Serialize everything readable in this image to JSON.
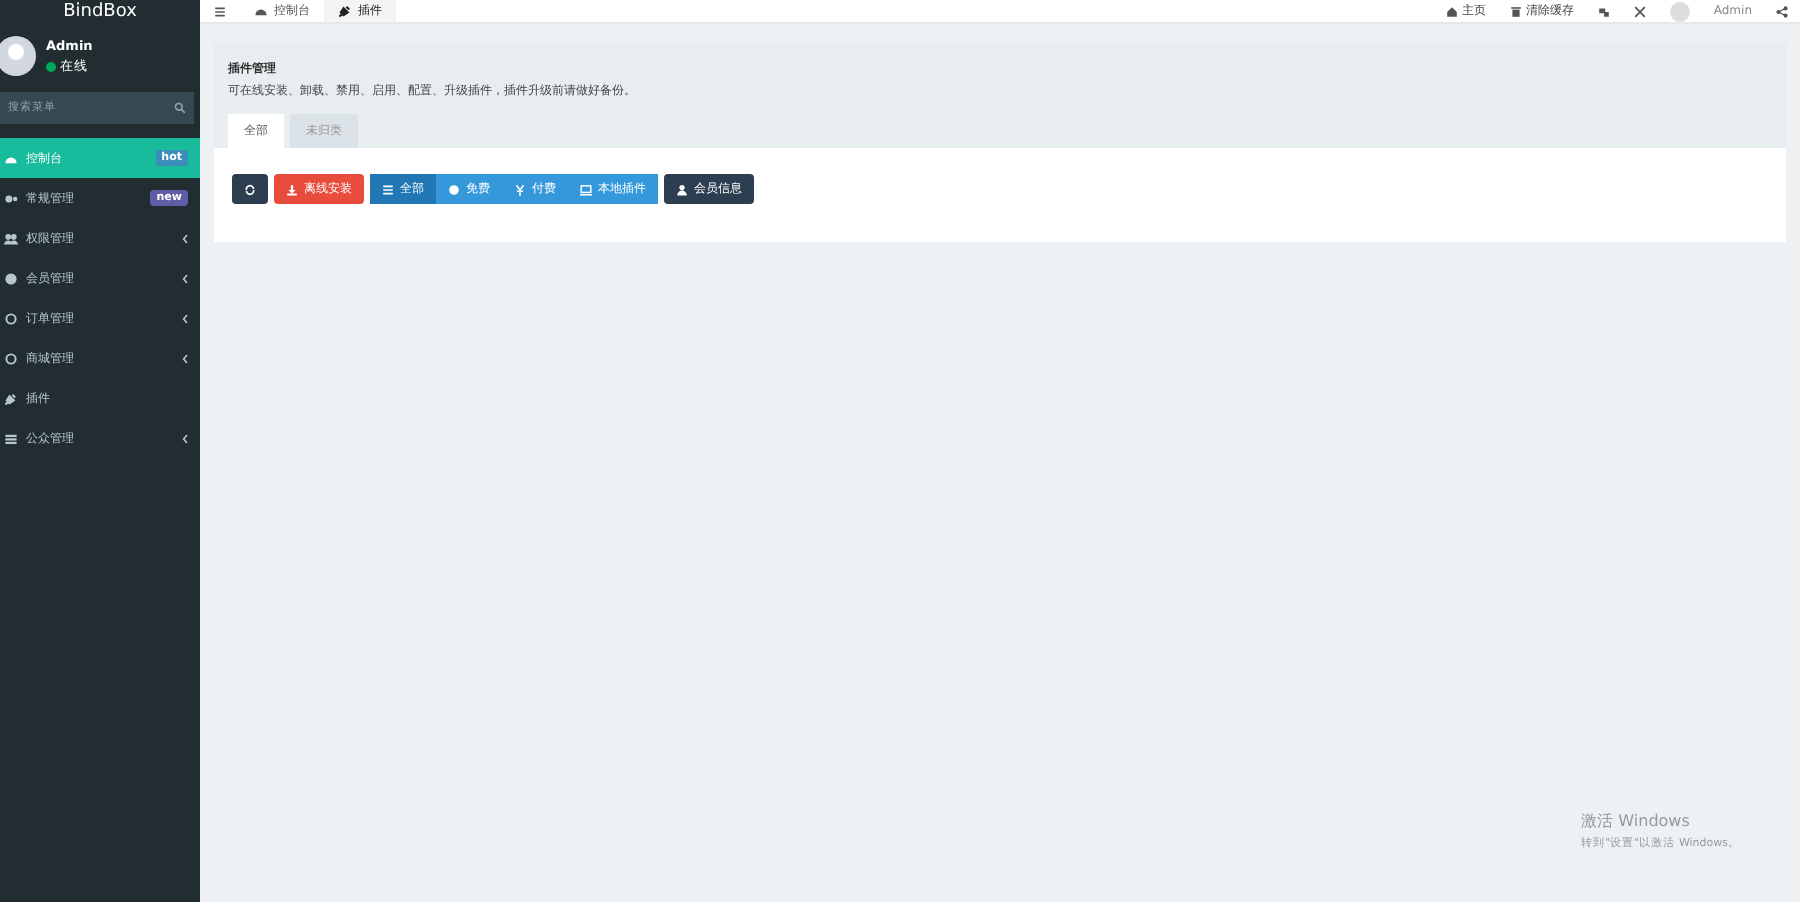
{
  "sidebar": {
    "logo": "BindBox",
    "user": {
      "name": "Admin",
      "status": "在线"
    },
    "search": {
      "placeholder": "搜索菜单"
    },
    "items": [
      {
        "label": "控制台",
        "selected": true,
        "expandable": false,
        "badge": {
          "text": "hot",
          "color": "#3c8dbc"
        }
      },
      {
        "label": "常规管理",
        "selected": false,
        "expandable": false,
        "badge": {
          "text": "new",
          "color": "#605ca8"
        }
      },
      {
        "label": "权限管理",
        "selected": false,
        "expandable": true
      },
      {
        "label": "会员管理",
        "selected": false,
        "expandable": true
      },
      {
        "label": "订单管理",
        "selected": false,
        "expandable": true
      },
      {
        "label": "商城管理",
        "selected": false,
        "expandable": true
      },
      {
        "label": "插件",
        "selected": false,
        "expandable": false
      },
      {
        "label": "公众管理",
        "selected": false,
        "expandable": true
      }
    ]
  },
  "topbar": {
    "tabs": [
      {
        "label": "控制台",
        "selected": false
      },
      {
        "label": "插件",
        "selected": true
      }
    ],
    "links": [
      "主页",
      "清除缓存"
    ],
    "user": "Admin"
  },
  "panel": {
    "title": "插件管理",
    "description": "可在线安装、卸载、禁用、启用、配置、升级插件，插件升级前请做好备份。",
    "tabs": [
      {
        "label": "全部",
        "selected": true
      },
      {
        "label": "未归类",
        "selected": false
      }
    ],
    "toolbar": [
      {
        "kind": "refresh"
      },
      {
        "kind": "danger",
        "label": "离线安装"
      },
      {
        "kind": "filters",
        "items": [
          {
            "label": "全部",
            "selected": true
          },
          {
            "label": "免费",
            "selected": false
          },
          {
            "label": "付费",
            "selected": false
          },
          {
            "label": "本地插件",
            "selected": false
          }
        ]
      },
      {
        "kind": "dark",
        "label": "会员信息"
      }
    ]
  },
  "os_notice": {
    "title": "激活 Windows",
    "text": "转到\"设置\"以激活 Windows。"
  }
}
